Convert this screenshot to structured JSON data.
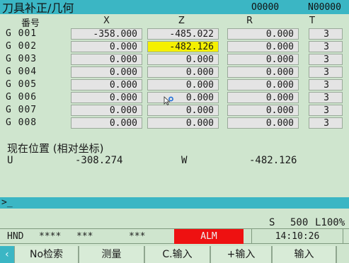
{
  "header": {
    "title": "刀具补正/几何",
    "program_number": "O0000",
    "sequence_number": "N00000"
  },
  "table": {
    "columns": {
      "num": "番号",
      "x": "X",
      "z": "Z",
      "r": "R",
      "t": "T"
    },
    "rows": [
      {
        "id": "G 001",
        "x": "-358.000",
        "z": "-485.022",
        "r": "0.000",
        "t": "3"
      },
      {
        "id": "G 002",
        "x": "0.000",
        "z": "-482.126",
        "r": "0.000",
        "t": "3"
      },
      {
        "id": "G 003",
        "x": "0.000",
        "z": "0.000",
        "r": "0.000",
        "t": "3"
      },
      {
        "id": "G 004",
        "x": "0.000",
        "z": "0.000",
        "r": "0.000",
        "t": "3"
      },
      {
        "id": "G 005",
        "x": "0.000",
        "z": "0.000",
        "r": "0.000",
        "t": "3"
      },
      {
        "id": "G 006",
        "x": "0.000",
        "z": "0.000",
        "r": "0.000",
        "t": "3"
      },
      {
        "id": "G 007",
        "x": "0.000",
        "z": "0.000",
        "r": "0.000",
        "t": "3"
      },
      {
        "id": "G 008",
        "x": "0.000",
        "z": "0.000",
        "r": "0.000",
        "t": "3"
      }
    ]
  },
  "position": {
    "title": "现在位置 (相对坐标)",
    "u_label": "U",
    "u_value": "-308.274",
    "w_label": "W",
    "w_value": "-482.126"
  },
  "input_line": {
    "prompt": ">_"
  },
  "spindle": {
    "label": "S",
    "value": "500",
    "load": "L100%"
  },
  "status": {
    "mode": "HND",
    "field1": "****",
    "field2": "***",
    "field3": "***",
    "alarm": "ALM",
    "time": "14:10:26"
  },
  "softkeys": {
    "prev_icon": "chevron-left-icon",
    "keys": [
      "No检索",
      "测量",
      "C.输入",
      "+输入",
      "输入"
    ],
    "next_icon": "chevron-right-icon"
  },
  "colors": {
    "background": "#cfe5ce",
    "accent": "#3bb6c4",
    "highlight": "#f5f000",
    "alarm": "#ee1111"
  }
}
